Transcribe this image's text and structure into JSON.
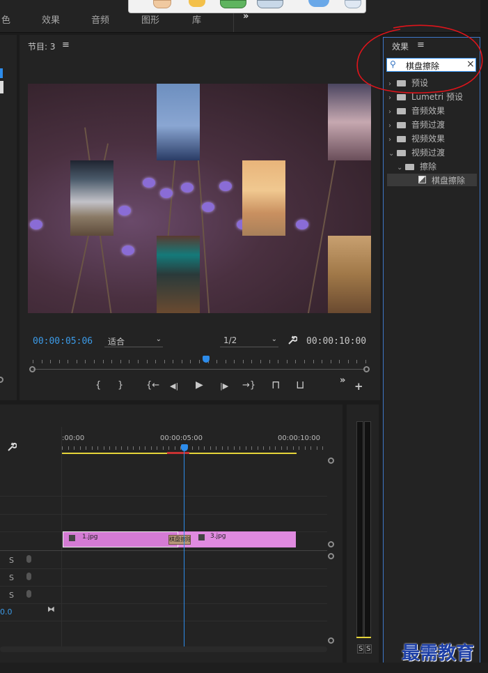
{
  "workspace_tabs": [
    "色",
    "效果",
    "音频",
    "图形",
    "库"
  ],
  "overflow_glyph": "»",
  "program_monitor": {
    "title": "节目: 3",
    "menu_glyph": "≡",
    "current_timecode": "00:00:05:06",
    "zoom_select": "适合",
    "resolution_select": "1/2",
    "duration_timecode": "00:00:10:00",
    "playhead_fraction": 0.52
  },
  "transport": {
    "mark_in": "{",
    "mark_out": "}",
    "go_to_in": "{←",
    "step_back": "◀|",
    "play": "▶",
    "step_forward": "|▶",
    "go_to_out": "→}",
    "lift": "⊓",
    "extract": "⊔",
    "more": "»",
    "add": "+"
  },
  "effects_panel": {
    "title": "效果",
    "menu_glyph": "≡",
    "search_value": "棋盘擦除",
    "clear_glyph": "×",
    "tree": [
      {
        "label": "预设",
        "expanded": false,
        "level": 0
      },
      {
        "label": "Lumetri 预设",
        "expanded": false,
        "level": 0
      },
      {
        "label": "音频效果",
        "expanded": false,
        "level": 0
      },
      {
        "label": "音频过渡",
        "expanded": false,
        "level": 0
      },
      {
        "label": "视频效果",
        "expanded": false,
        "level": 0
      },
      {
        "label": "视频过渡",
        "expanded": true,
        "level": 0
      },
      {
        "label": "擦除",
        "expanded": true,
        "level": 1
      },
      {
        "label": "棋盘擦除",
        "level": 2,
        "selected": true
      }
    ]
  },
  "timeline": {
    "ruler_labels": [
      ":00:00",
      "00:00:05:00",
      "00:00:10:00"
    ],
    "clips": [
      {
        "label": "1.jpg",
        "color": "#d47bd4"
      },
      {
        "label": "3.jpg",
        "color": "#e08ae0"
      }
    ],
    "transition_label": "棋盘擦除",
    "audio_tracks": [
      {
        "solo": "S"
      },
      {
        "solo": "S"
      },
      {
        "solo": "S"
      }
    ],
    "master_value": "0.0"
  },
  "meter": {
    "solo_labels": [
      "S",
      "S"
    ]
  },
  "watermark": "最需教育",
  "colors": {
    "accent_blue": "#2d8ceb",
    "timecode_blue": "#3c9be8",
    "annotation_red": "#e0141b",
    "clip_pink": "#e08ae0",
    "work_area_yellow": "#e5d43a"
  }
}
